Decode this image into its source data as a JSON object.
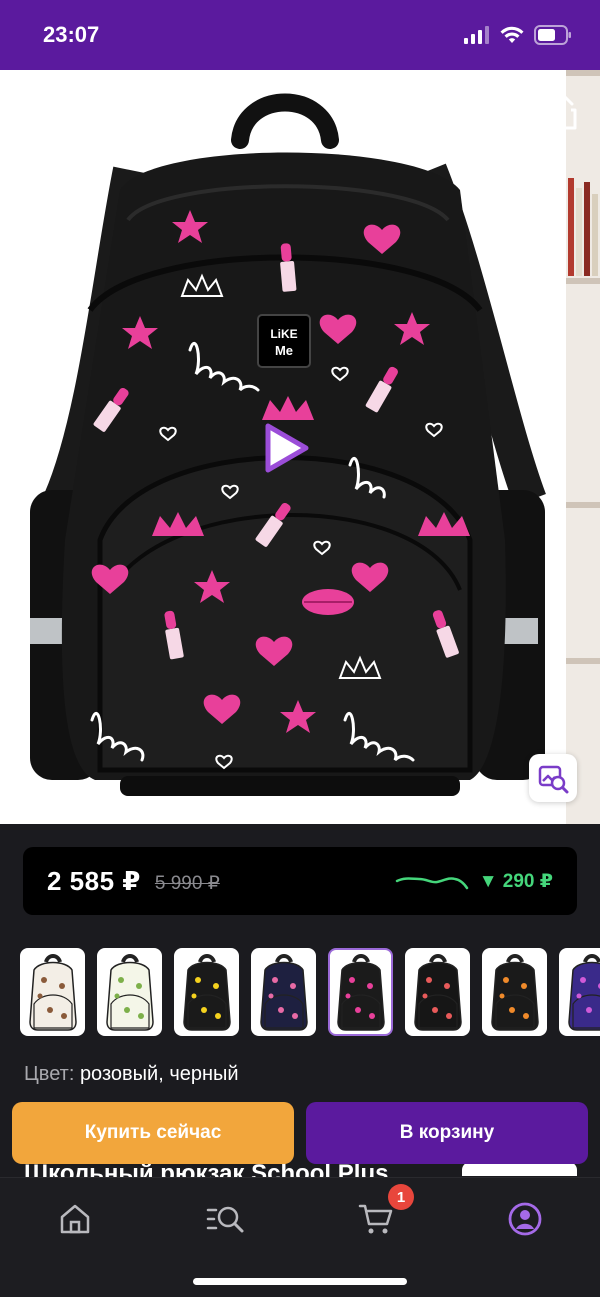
{
  "status_bar": {
    "time": "23:07"
  },
  "gallery": {
    "product_image": "backpack-black-pink-love-print",
    "brand_patch": "LIKE ME"
  },
  "price": {
    "current": "2 585 ₽",
    "old": "5 990 ₽",
    "drop": "▼ 290 ₽",
    "drop_color": "#45d67b"
  },
  "variants": [
    {
      "name": "cream-print",
      "bg": "#f3eee6",
      "accent": "#8a5a3a"
    },
    {
      "name": "avocado",
      "bg": "#f4f6e8",
      "accent": "#7db04a"
    },
    {
      "name": "banana",
      "bg": "#1a1a1a",
      "accent": "#f5d21e"
    },
    {
      "name": "navy-stars",
      "bg": "#1e2040",
      "accent": "#e86aa6"
    },
    {
      "name": "black-love",
      "bg": "#1b1b1b",
      "accent": "#e8409a"
    },
    {
      "name": "black-stickers",
      "bg": "#161616",
      "accent": "#e85a5a"
    },
    {
      "name": "black-foxes",
      "bg": "#1a1a1a",
      "accent": "#f08a2a"
    },
    {
      "name": "galaxy",
      "bg": "#3a2a8a",
      "accent": "#d05ad8"
    }
  ],
  "color": {
    "label": "Цвет:",
    "value": "розовый, черный"
  },
  "actions": {
    "buy_now": "Купить сейчас",
    "add_to_cart": "В корзину"
  },
  "peek": {
    "title": "Школьный рюкзак School Plus"
  },
  "tabbar": {
    "cart_count": "1"
  },
  "colors": {
    "brand": "#5b1a9e",
    "buy": "#f2a63c",
    "badge": "#e8463c"
  }
}
